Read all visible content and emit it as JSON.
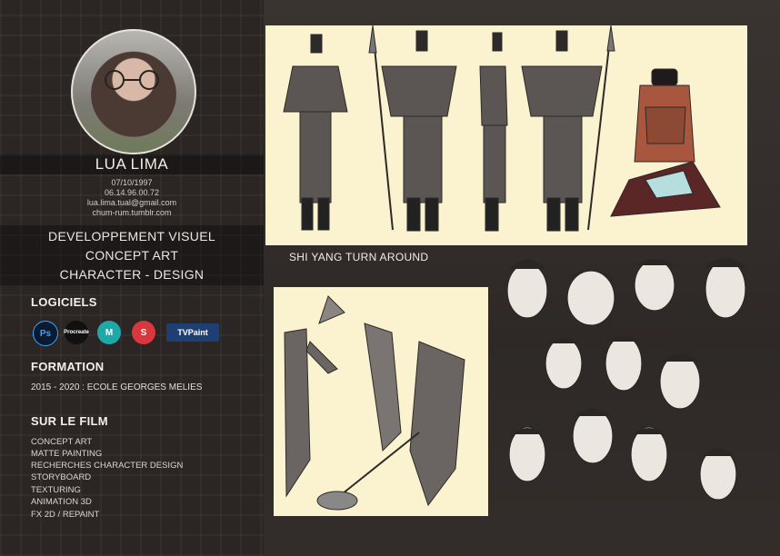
{
  "profile": {
    "name": "LUA LIMA",
    "birthdate": "07/10/1997",
    "phone": "06.14.96.00.72",
    "email": "lua.lima.tual@gmail.com",
    "website": "chum-rum.tumblr.com"
  },
  "roles": [
    "DEVELOPPEMENT VISUEL",
    "CONCEPT ART",
    "CHARACTER - DESIGN"
  ],
  "software": {
    "title": "LOGICIELS",
    "apps": [
      {
        "icon": "photoshop-icon",
        "label": "Ps",
        "color": "#0a1a33",
        "text": "#31a8ff"
      },
      {
        "icon": "procreate-icon",
        "label": "Procreate",
        "color": "#111111",
        "text": "#ffffff"
      },
      {
        "icon": "maya-icon",
        "label": "M",
        "color": "#1fa8a8",
        "text": "#ffffff"
      },
      {
        "icon": "substance-icon",
        "label": "S",
        "color": "#d9363e",
        "text": "#ffffff"
      },
      {
        "icon": "tvpaint-icon",
        "label": "TVPaint",
        "color": "#1e3f73",
        "text": "#ffffff"
      }
    ]
  },
  "formation": {
    "title": "FORMATION",
    "text": "2015 - 2020 : ECOLE GEORGES MELIES"
  },
  "film": {
    "title": "SUR LE FILM",
    "items": [
      "CONCEPT ART",
      "MATTE PAINTING",
      "RECHERCHES CHARACTER DESIGN",
      "STORYBOARD",
      "TEXTURING",
      "ANIMATION 3D",
      "FX 2D / REPAINT"
    ]
  },
  "artwork": {
    "turnaround_caption": "SHI YANG TURN AROUND"
  },
  "colors": {
    "panel": "#fbf3cf",
    "sidebar": "#2b2624",
    "figure": "#5b5553"
  }
}
